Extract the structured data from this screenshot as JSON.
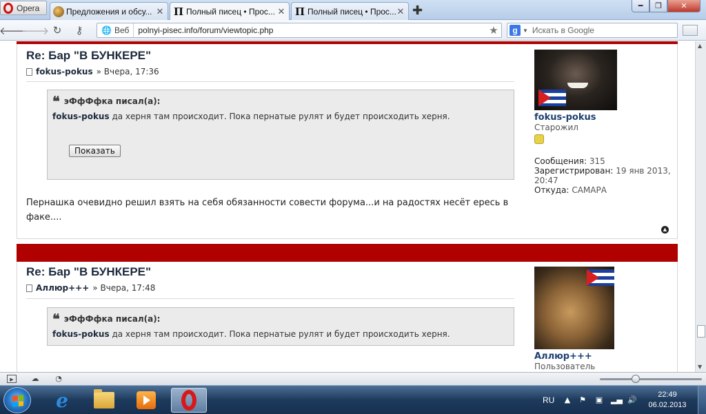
{
  "browser": {
    "menu_label": "Opera",
    "tabs": [
      {
        "title": "Предложения и обсу...",
        "active": false
      },
      {
        "title": "Полный писец • Прос...",
        "active": true
      },
      {
        "title": "Полный писец • Прос...",
        "active": false
      }
    ],
    "tab_favicon_letter": "П",
    "new_tab_icon": "plus-icon",
    "address": {
      "scheme_label": "Веб",
      "url": "polnyi-pisec.info/forum/viewtopic.php"
    },
    "search": {
      "placeholder": "Искать в Google",
      "engine_letter": "g"
    }
  },
  "posts": [
    {
      "title": "Re: Бар \"В БУНКЕРЕ\"",
      "author": "fokus-pokus",
      "time": "» Вчера, 17:36",
      "quote": {
        "author_line": "эФфФфка писал(а):",
        "quoted_user": "fokus-pokus",
        "text": "да херня там происходит. Пока пернатые рулят и будет происходить херня.",
        "spoiler_button": "Показать"
      },
      "body": "Пернашка очевидно решил взять на себя обязанности совести форума...и на радостях несёт ересь в факе....",
      "profile": {
        "username": "fokus-pokus",
        "rank": "Старожил",
        "messages_label": "Сообщения:",
        "messages": "315",
        "registered_label": "Зарегистрирован:",
        "registered": "19 янв 2013, 20:47",
        "from_label": "Откуда:",
        "from": "САМАРА"
      }
    },
    {
      "title": "Re: Бар \"В БУНКЕРЕ\"",
      "author": "Аллюр+++",
      "time": "» Вчера, 17:48",
      "quote": {
        "author_line": "эФфФфка писал(а):",
        "quoted_user": "fokus-pokus",
        "text": "да херня там происходит. Пока пернатые рулят и будет происходить херня."
      },
      "profile": {
        "username": "Аллюр+++",
        "rank": "Пользователь"
      }
    }
  ],
  "taskbar": {
    "language": "RU",
    "time": "22:49",
    "date": "06.02.2013"
  },
  "colors": {
    "forum_red": "#b00000",
    "link_blue": "#1d3f70",
    "opera_red": "#d81818"
  }
}
